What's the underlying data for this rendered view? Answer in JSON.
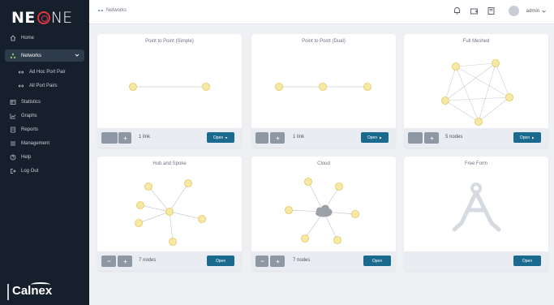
{
  "brand": {
    "ne": "NE",
    "one": "NE"
  },
  "topbar": {
    "breadcrumb": "Networks",
    "user": "admin"
  },
  "nav": {
    "home": "Home",
    "networks": "Networks",
    "ad_hoc": "Ad Hoc Port Pair",
    "all_port_pairs": "All Port Pairs",
    "statistics": "Statistics",
    "graphs": "Graphs",
    "reports": "Reports",
    "management": "Management",
    "help": "Help",
    "logout": "Log Out"
  },
  "footer_brand": "Calnex",
  "cards": [
    {
      "title": "Point to Point (Simple)",
      "count": "1 link",
      "open": "Open"
    },
    {
      "title": "Point to Point (Dual)",
      "count": "1 link",
      "open": "Open"
    },
    {
      "title": "Full Meshed",
      "count": "5 nodes",
      "open": "Open"
    },
    {
      "title": "Hub and Spoke",
      "count": "7 nodes",
      "open": "Open"
    },
    {
      "title": "Cloud",
      "count": "7 nodes",
      "open": "Open"
    },
    {
      "title": "Free Form",
      "open": "Open"
    }
  ],
  "colors": {
    "sidebar": "#16202c",
    "accent": "#1a6a8f",
    "node": "#f6e9a5",
    "node_stroke": "#e3c65a",
    "brand_red": "#e0373f"
  },
  "icons": {
    "home": "home-icon",
    "networks": "network-icon",
    "ad_hoc": "arrows-icon",
    "all_port_pairs": "arrows-icon",
    "statistics": "table-icon",
    "graphs": "chart-icon",
    "reports": "report-icon",
    "management": "list-icon",
    "help": "help-icon",
    "logout": "logout-icon",
    "bell": "bell-icon",
    "camera": "camera-icon",
    "book": "book-icon"
  }
}
